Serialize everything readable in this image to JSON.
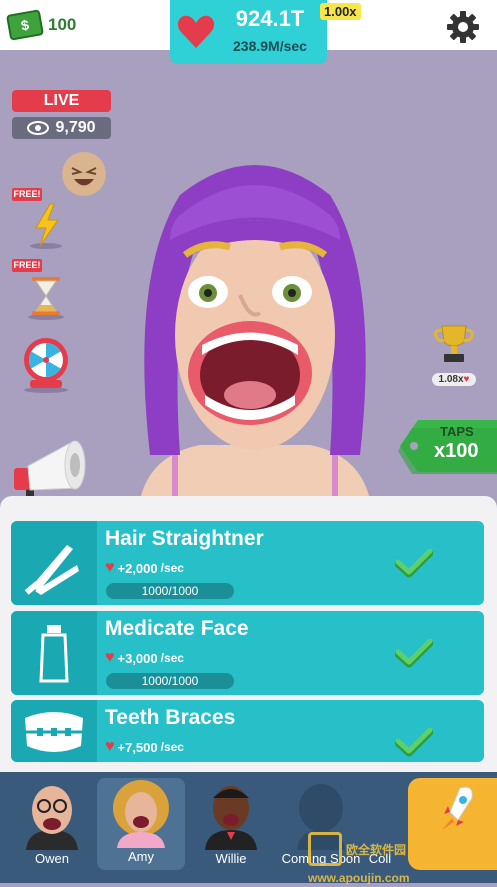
{
  "hud": {
    "cash_value": "100",
    "cash_icon": "dollar-bill-icon",
    "score_value": "924.1T",
    "score_rate": "238.9M/sec",
    "multiplier": "1.00x",
    "settings_icon": "gear-icon"
  },
  "stream": {
    "live_label": "LIVE",
    "viewer_count": "9,790"
  },
  "boosts": {
    "free_label_1": "FREE!",
    "free_label_2": "FREE!",
    "trophy_multiplier": "1.08x"
  },
  "taps": {
    "label": "TAPS",
    "value": "x100"
  },
  "upgrades": [
    {
      "title": "Hair Straightner",
      "rate": "+2,000",
      "unit": "/sec",
      "progress": "1000/1000",
      "icon": "hair-straightener-icon",
      "progress_fraction": 1.0
    },
    {
      "title": "Medicate Face",
      "rate": "+3,000",
      "unit": "/sec",
      "progress": "1000/1000",
      "icon": "cream-tube-icon",
      "progress_fraction": 1.0
    },
    {
      "title": "Teeth Braces",
      "rate": "+7,500",
      "unit": "/sec",
      "icon": "braces-icon"
    }
  ],
  "characters": [
    {
      "name": "Owen"
    },
    {
      "name": "Amy"
    },
    {
      "name": "Willie"
    },
    {
      "name": "Coming Soon"
    },
    {
      "name": "Coll"
    }
  ],
  "colors": {
    "background": "#a99fbf",
    "accent_cyan": "#27bfc8",
    "heart_red": "#e43c4a",
    "bottom_bar": "#3a5a7c"
  },
  "watermark_text": "欧全软件园 www.apoujin.com"
}
